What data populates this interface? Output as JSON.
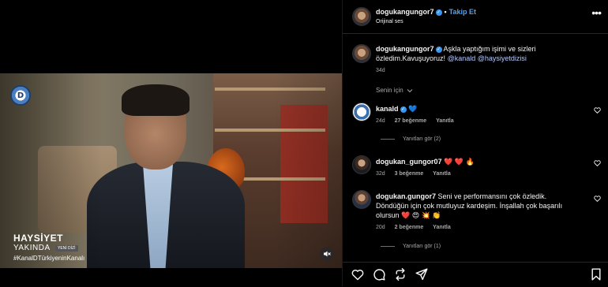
{
  "video": {
    "channel_logo_text": "D",
    "show_title": "HAYSİYET",
    "show_subtitle": "YAKINDA",
    "show_badge": "YENİ DİZİ",
    "show_hashtag": "#KanalDTürkiyeninKanalı"
  },
  "header": {
    "username": "dogukangungor7",
    "verified": true,
    "separator": "•",
    "follow_label": "Takip Et",
    "audio_label": "Orijinal ses",
    "more_icon": "more-icon"
  },
  "caption": {
    "username": "dogukangungor7",
    "text": "Aşkla yaptığım işimi ve sizleri özledim.Kavuşuyoruz!",
    "mention1": "@kanald",
    "mention2": "@haysiyetdizisi",
    "time": "34d"
  },
  "sort_label": "Senin için",
  "comments": [
    {
      "username": "kanald",
      "verified": true,
      "text": "💙",
      "time": "24d",
      "likes": "27 beğenme",
      "reply": "Yanıtla",
      "view_replies": "Yanıtları gör (2)"
    },
    {
      "username": "dogukan_gungor07",
      "verified": false,
      "text": "❤️ ❤️ 🔥",
      "time": "32d",
      "likes": "3 beğenme",
      "reply": "Yanıtla"
    },
    {
      "username": "dogukan.gungor7",
      "verified": false,
      "text": "Seni ve performansını çok özledik. Döndüğün için çok mutluyuz kardeşim. İnşallah çok başarılı olursun ❤️ 😍 💥 👏",
      "time": "20d",
      "likes": "2 beğenme",
      "reply": "Yanıtla",
      "view_replies": "Yanıtları gör (1)"
    }
  ],
  "footer_icons": [
    "heart-icon",
    "comment-icon",
    "repost-icon",
    "share-icon",
    "bookmark-icon"
  ],
  "colors": {
    "accent": "#4aa3ff",
    "mention": "#b4c8ff",
    "muted": "#a8a8a8",
    "verified": "#3897f0"
  }
}
